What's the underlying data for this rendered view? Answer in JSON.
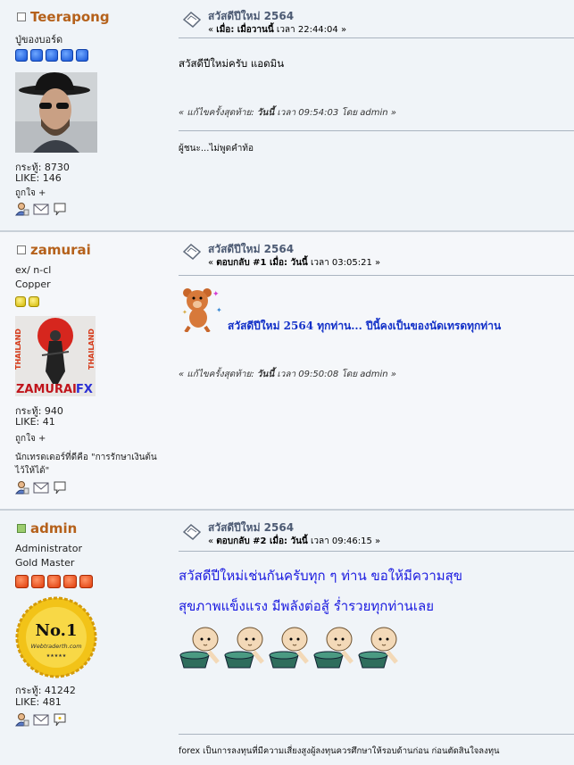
{
  "posts": [
    {
      "username": "Teerapong",
      "online": false,
      "title_line": "ปู่ของบอร์ด",
      "stars": 5,
      "points_label": "กระทู้: 8730",
      "like_label": "LIKE: 146",
      "like_action": "ถูกใจ +",
      "subject": "สวัสดีปีใหม่ 2564",
      "when_prefix": "« ",
      "when_bold": "เมื่อ: เมื่อวานนี้",
      "when_suffix": " เวลา 22:44:04 »",
      "message": "สวัสดีปีใหม่ครับ แอดมิน",
      "edited_prefix": "« แก้ไขครั้งสุดท้าย: ",
      "edited_bold": "วันนี้",
      "edited_suffix": " เวลา 09:54:03  โดย admin »",
      "signature": "ผู้ชนะ...ไม่พูดคำท้อ"
    },
    {
      "username": "zamurai",
      "online": false,
      "title_line": "ex/ n-cl",
      "rank": "Copper",
      "stars": 2,
      "avatar_text": {
        "left": "THAILAND",
        "right": "THAILAND",
        "brand": "ZAMURAI",
        "brand2": "FX"
      },
      "points_label": "กระทู้: 940",
      "like_label": "LIKE: 41",
      "like_action": "ถูกใจ +",
      "personal_text_1": "นักเทรดเดอร์ที่ดีคือ \"การรักษาเงินต้น",
      "personal_text_2": "ไว้ให้ได้\"",
      "subject": "สวัสดีปีใหม่ 2564",
      "when_prefix": "« ",
      "when_bold": "ตอบกลับ #1 เมื่อ: วันนี้",
      "when_suffix": " เวลา 03:05:21 »",
      "message": "สวัสดีปีใหม่ 2564 ทุกท่าน... ปีนี้คงเป็นของนัดเทรดทุกท่าน",
      "edited_prefix": "« แก้ไขครั้งสุดท้าย: ",
      "edited_bold": "วันนี้",
      "edited_suffix": " เวลา 09:50:08  โดย admin »"
    },
    {
      "username": "admin",
      "online": true,
      "title_line": "Administrator",
      "rank": "Gold Master",
      "stars": 5,
      "badge": {
        "big": "No.1",
        "small": "Webtraderth.com"
      },
      "points_label": "กระทู้: 41242",
      "like_label": "LIKE: 481",
      "subject": "สวัสดีปีใหม่ 2564",
      "when_prefix": "« ",
      "when_bold": "ตอบกลับ #2 เมื่อ:  วันนี้",
      "when_suffix": " เวลา 09:46:15 »",
      "message_line1": "สวัสดีปีใหม่เช่นกันครับทุก ๆ ท่าน   ขอให้มีความสุข",
      "message_line2": "สุขภาพแข็งแรง   มีพลังต่อสู้   ร่ำรวยทุกท่านเลย",
      "signature": "forex เป็นการลงทุนที่มีความเสี่ยงสูงผู้ลงทุนควรศึกษาให้รอบด้านก่อน ก่อนตัดสินใจลงทุน"
    }
  ],
  "colors": {
    "username": "#b5611b",
    "subject": "#4c5a73",
    "message_blue": "#1a1ae0"
  },
  "icons": [
    "profile-icon",
    "email-icon",
    "message-icon"
  ]
}
